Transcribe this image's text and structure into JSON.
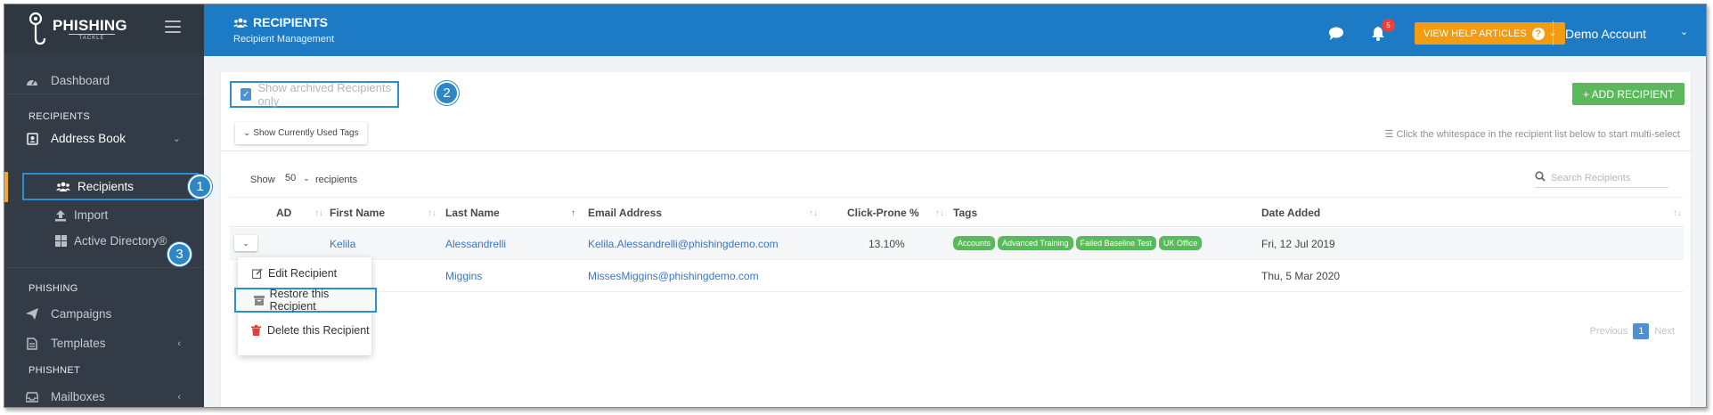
{
  "brand": {
    "name": "PHISHING",
    "sub": "TACKLE"
  },
  "sidebar": {
    "dashboard": "Dashboard",
    "sections": [
      "RECIPIENTS",
      "PHISHING",
      "PHISHNET"
    ],
    "address_book": "Address Book",
    "recipients": "Recipients",
    "import": "Import",
    "active_directory": "Active Directory®",
    "campaigns": "Campaigns",
    "templates": "Templates",
    "mailboxes": "Mailboxes"
  },
  "header": {
    "title": "RECIPIENTS",
    "subtitle": "Recipient Management",
    "notifications": "5",
    "help_label": "VIEW HELP ARTICLES",
    "account": "Demo Account"
  },
  "toolbar": {
    "archived_label": "Show archived Recipients only",
    "add_label": "+ ADD RECIPIENT",
    "tags_toggle": "Show Currently Used Tags",
    "multi_select_hint": "Click the whitespace in the recipient list below to start multi-select"
  },
  "list_controls": {
    "show": "Show",
    "page_size": "50",
    "recipients": "recipients",
    "search_placeholder": "Search Recipients"
  },
  "table": {
    "columns": [
      "AD",
      "First Name",
      "Last Name",
      "Email Address",
      "Click-Prone %",
      "Tags",
      "Date Added"
    ],
    "rows": [
      {
        "first": "Kelila",
        "last": "Alessandrelli",
        "email": "Kelila.Alessandrelli@phishingdemo.com",
        "click_prone": "13.10%",
        "tags": [
          "Accounts",
          "Advanced Training",
          "Failed Baseline Test",
          "UK Office"
        ],
        "date": "Fri, 12 Jul 2019"
      },
      {
        "first": "",
        "last": "Miggins",
        "email": "MissesMiggins@phishingdemo.com",
        "click_prone": "",
        "tags": [],
        "date": "Thu, 5 Mar 2020"
      }
    ]
  },
  "row_menu": {
    "edit": "Edit Recipient",
    "restore": "Restore this Recipient",
    "delete": "Delete this Recipient"
  },
  "pager": {
    "previous": "Previous",
    "page": "1",
    "next": "Next"
  },
  "callouts": [
    "1",
    "2",
    "3"
  ],
  "colors": {
    "header": "#1d7bc6",
    "sidebar": "#333c46",
    "accent_green": "#5cb85c",
    "help_orange": "#f39c12",
    "highlight": "#2f8ed1"
  }
}
